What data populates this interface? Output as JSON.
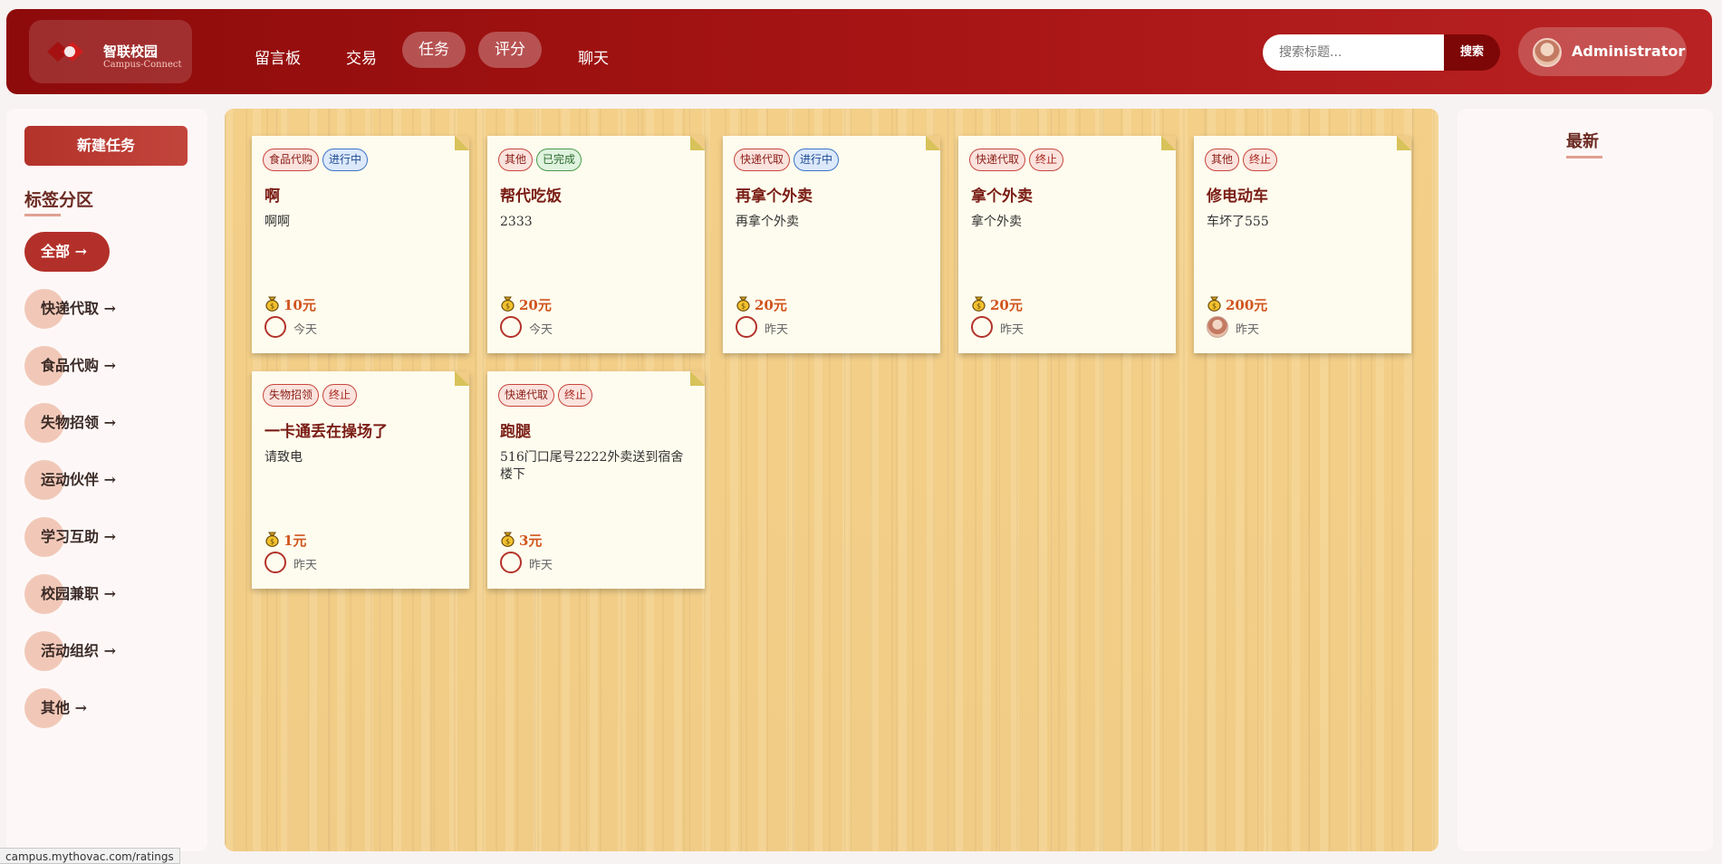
{
  "header": {
    "logo_title": "智联校园",
    "logo_sub": "Campus-Connect",
    "nav": [
      {
        "label": "留言板",
        "active": false
      },
      {
        "label": "交易",
        "active": false
      },
      {
        "label": "任务",
        "active": true
      },
      {
        "label": "评分",
        "active": true
      },
      {
        "label": "聊天",
        "active": false
      }
    ],
    "search_placeholder": "搜索标题...",
    "search_button": "搜索",
    "user_name": "Administrator"
  },
  "sidebar": {
    "new_task": "新建任务",
    "title": "标签分区",
    "tags": [
      "全部 →",
      "快递代取 →",
      "食品代购 →",
      "失物招领 →",
      "运动伙伴 →",
      "学习互助 →",
      "校园兼职 →",
      "活动组织 →",
      "其他 →"
    ]
  },
  "tasks": [
    {
      "category": "食品代购",
      "status": "进行中",
      "title": "啊",
      "desc": "啊啊",
      "reward": "10元",
      "when": "今天",
      "avatar": false
    },
    {
      "category": "其他",
      "status": "已完成",
      "title": "帮代吃饭",
      "desc": "2333",
      "reward": "20元",
      "when": "今天",
      "avatar": false
    },
    {
      "category": "快递代取",
      "status": "进行中",
      "title": "再拿个外卖",
      "desc": "再拿个外卖",
      "reward": "20元",
      "when": "昨天",
      "avatar": false
    },
    {
      "category": "快递代取",
      "status": "终止",
      "title": "拿个外卖",
      "desc": "拿个外卖",
      "reward": "20元",
      "when": "昨天",
      "avatar": false
    },
    {
      "category": "其他",
      "status": "终止",
      "title": "修电动车",
      "desc": "车坏了555",
      "reward": "200元",
      "when": "昨天",
      "avatar": true
    },
    {
      "category": "失物招领",
      "status": "终止",
      "title": "一卡通丢在操场了",
      "desc": "请致电",
      "reward": "1元",
      "when": "昨天",
      "avatar": false
    },
    {
      "category": "快递代取",
      "status": "终止",
      "title": "跑腿",
      "desc": "516门口尾号2222外卖送到宿舍楼下",
      "reward": "3元",
      "when": "昨天",
      "avatar": false
    }
  ],
  "right_panel": {
    "title": "最新"
  },
  "status_url": "campus.mythovac.com/ratings",
  "colors": {
    "header": "#a81515",
    "accent": "#b3322a",
    "board": "#f3cf88",
    "card": "#fefcee"
  }
}
